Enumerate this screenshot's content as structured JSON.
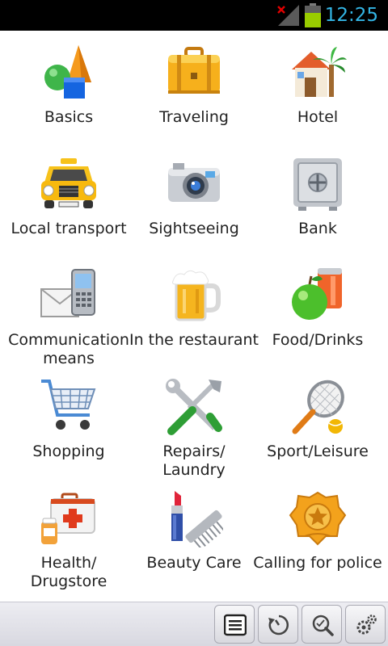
{
  "status_bar": {
    "time": "12:25",
    "icons": [
      "signal-no-connection-icon",
      "battery-icon"
    ]
  },
  "categories": [
    {
      "label": "Basics",
      "icon": "shapes-icon"
    },
    {
      "label": "Traveling",
      "icon": "suitcase-icon"
    },
    {
      "label": "Hotel",
      "icon": "house-palm-icon"
    },
    {
      "label": "Local transport",
      "icon": "taxi-icon"
    },
    {
      "label": "Sightseeing",
      "icon": "camera-icon"
    },
    {
      "label": "Bank",
      "icon": "safe-icon"
    },
    {
      "label": "Communication means",
      "icon": "mail-phone-icon"
    },
    {
      "label": "In the restaurant",
      "icon": "beer-mug-icon"
    },
    {
      "label": "Food/Drinks",
      "icon": "apple-can-icon"
    },
    {
      "label": "Shopping",
      "icon": "shopping-cart-icon"
    },
    {
      "label": "Repairs/ Laundry",
      "icon": "tools-icon"
    },
    {
      "label": "Sport/Leisure",
      "icon": "tennis-icon"
    },
    {
      "label": "Health/ Drugstore",
      "icon": "first-aid-kit-icon"
    },
    {
      "label": "Beauty Care",
      "icon": "lipstick-comb-icon"
    },
    {
      "label": "Calling for police",
      "icon": "police-badge-icon"
    }
  ],
  "toolbar": {
    "buttons": [
      {
        "name": "list-button",
        "icon": "list-icon"
      },
      {
        "name": "history-button",
        "icon": "history-icon"
      },
      {
        "name": "search-button",
        "icon": "search-icon"
      },
      {
        "name": "settings-button",
        "icon": "gears-icon"
      }
    ]
  }
}
